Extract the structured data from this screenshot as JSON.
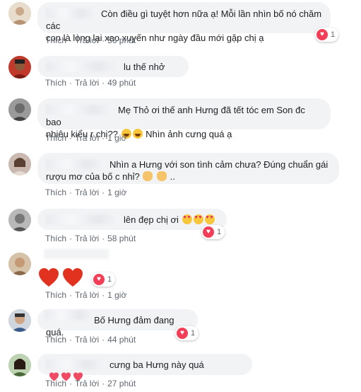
{
  "actions": {
    "like": "Thích",
    "reply": "Trả lời",
    "dot": "·"
  },
  "colors": {
    "bubble": "#f2f3f5",
    "meta": "#606770",
    "love": "#f33e58"
  },
  "comments": [
    {
      "text": "Còn điều gì tuyệt hơn nữa ạ! Mỗi lần nhìn bố nó chăm các\ncon là lòng lại xao xuyến như ngày đầu mới gặp chị ạ",
      "time": "56 phút",
      "reaction_count": "1"
    },
    {
      "text": "lu thế nhở",
      "time": "49 phút"
    },
    {
      "text": "Mẹ Thỏ ơi thế anh Hưng đã tết tóc em Son đc bao\nnhiêu kiểu r chị??",
      "emoji_text": "Nhìn ảnh cưng quá ạ",
      "time": "1 giờ"
    },
    {
      "text": "Nhìn a Hưng với son tình cảm chưa? Đúng chuẩn gái\nrượu mơ của bố c nhỉ?",
      "trail": "..",
      "time": "1 giờ"
    },
    {
      "text": "lên đẹp chị ơi",
      "time": "58 phút",
      "reaction_count": "1"
    },
    {
      "time": "1 giờ",
      "reaction_count": "1"
    },
    {
      "text": "Bố Hưng đảm đang quá.",
      "time": "44 phút",
      "reaction_count": "1"
    },
    {
      "text": "cưng ba Hưng này quá",
      "time": "27 phút"
    }
  ]
}
